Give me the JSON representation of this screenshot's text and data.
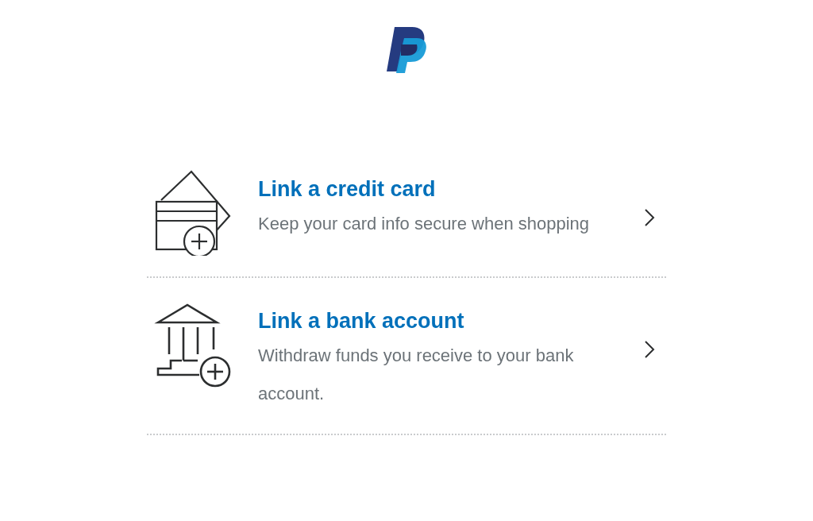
{
  "options": [
    {
      "kind": "card",
      "title": "Link a credit card",
      "description": "Keep your card info secure when shopping"
    },
    {
      "kind": "bank",
      "title": "Link a bank account",
      "description": "Withdraw funds you receive to your bank account."
    }
  ]
}
